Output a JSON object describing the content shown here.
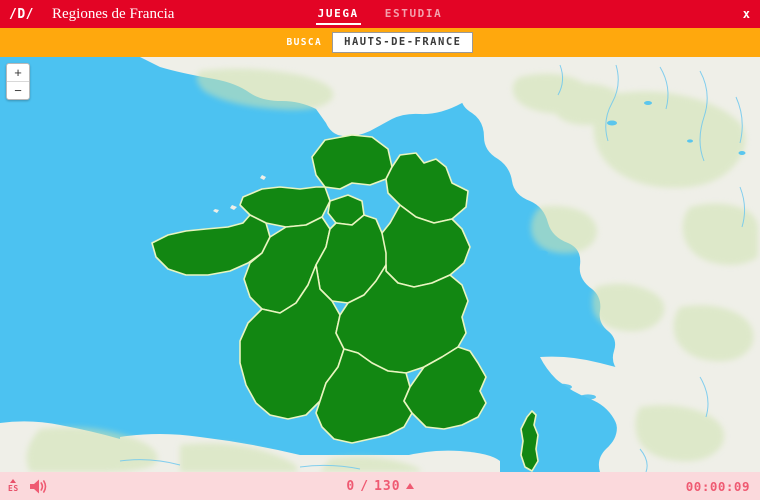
{
  "header": {
    "logo": "/D/",
    "title": "Regiones de Francia",
    "tabs": [
      {
        "label": "JUEGA",
        "active": true
      },
      {
        "label": "ESTUDIA",
        "active": false
      }
    ],
    "close_label": "x"
  },
  "prompt": {
    "label": "BUSCA",
    "answer": "HAUTS-DE-FRANCE"
  },
  "map": {
    "zoom_in": "+",
    "zoom_out": "−",
    "water_color": "#4cc2f1",
    "land_color": "#efefe8",
    "region_fill": "#128712",
    "region_border": "#e9f5c0",
    "terrain_green": "#cfe3b0"
  },
  "footer": {
    "language": "ES",
    "sound_icon": "speaker-icon",
    "score_current": "0",
    "score_separator": "/",
    "score_total": "130",
    "timer": "00:00:09",
    "accent_color": "#ef5a72",
    "background": "#fbd9dc"
  }
}
